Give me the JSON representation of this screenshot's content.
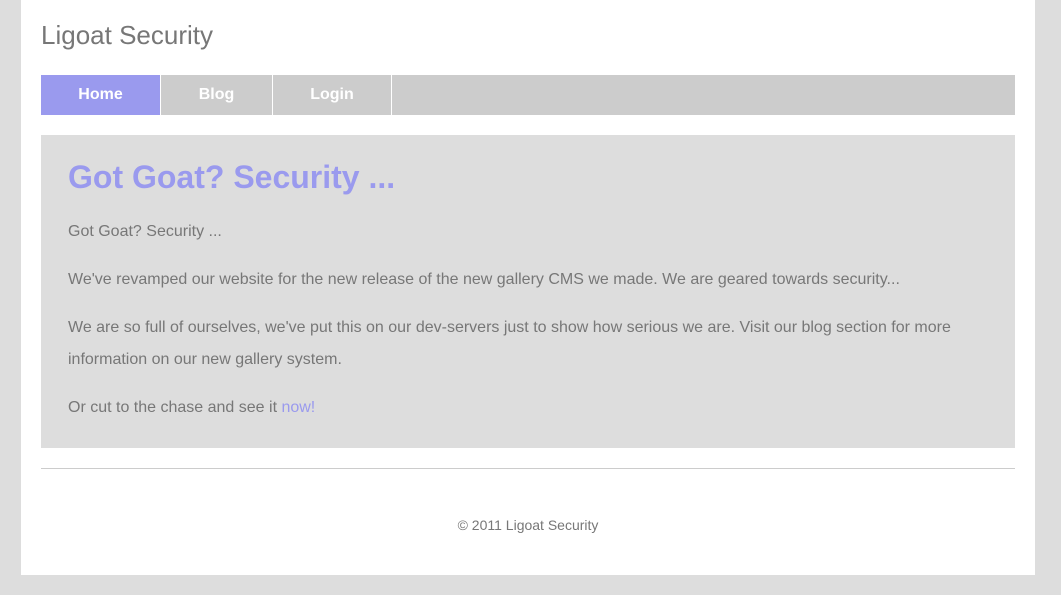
{
  "site": {
    "title": "Ligoat Security"
  },
  "nav": {
    "items": [
      {
        "label": "Home",
        "active": true
      },
      {
        "label": "Blog",
        "active": false
      },
      {
        "label": "Login",
        "active": false
      }
    ]
  },
  "main": {
    "headline": "Got Goat? Security ...",
    "paragraphs": [
      "Got Goat? Security ...",
      "We've revamped our website for the new release of the new gallery CMS we made. We are geared towards security...",
      "We are so full of ourselves, we've put this on our dev-servers just to show how serious we are. Visit our blog section for more information on our new gallery system."
    ],
    "cta_prefix": "Or cut to the chase and see it ",
    "cta_link": "now!"
  },
  "footer": {
    "copyright": "© 2011 Ligoat Security"
  },
  "colors": {
    "accent": "#9a9aee",
    "text": "#777777",
    "nav_bg": "#cccccc",
    "content_bg": "#dddddd"
  }
}
